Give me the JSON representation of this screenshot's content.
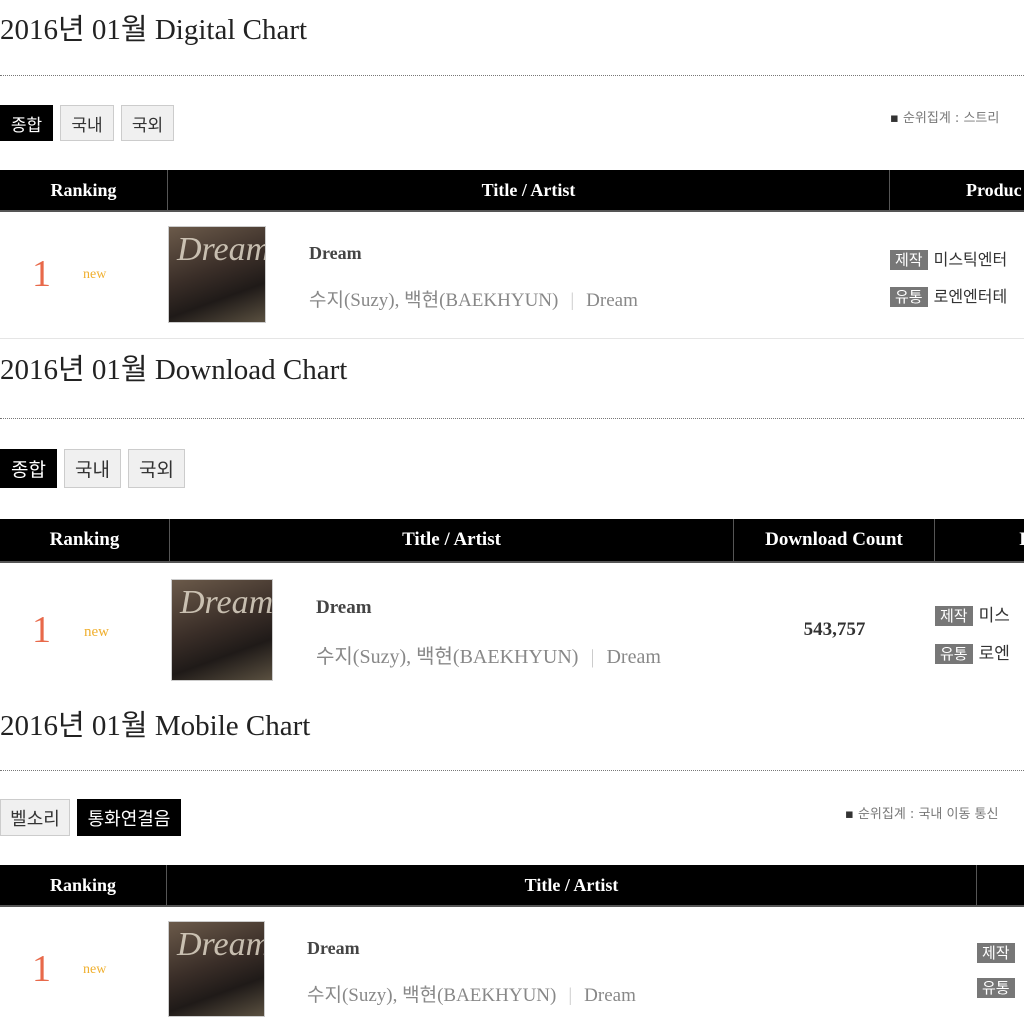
{
  "digital": {
    "title": "2016년 01월 Digital Chart",
    "tabs": [
      "종합",
      "국내",
      "국외"
    ],
    "note": "순위집계 : 스트리",
    "headers": [
      "Ranking",
      "Title / Artist",
      "Produc"
    ],
    "rows": [
      {
        "rank": "1",
        "badge": "new",
        "song": "Dream",
        "artist": "수지(Suzy), 백현(BAEKHYUN)",
        "album": "Dream",
        "producer_label": "제작",
        "producer": "미스틱엔터",
        "distributor_label": "유통",
        "distributor": "로엔엔터테"
      }
    ]
  },
  "download": {
    "title": "2016년 01월 Download Chart",
    "tabs": [
      "종합",
      "국내",
      "국외"
    ],
    "headers": [
      "Ranking",
      "Title / Artist",
      "Download Count",
      "I"
    ],
    "rows": [
      {
        "rank": "1",
        "badge": "new",
        "song": "Dream",
        "artist": "수지(Suzy), 백현(BAEKHYUN)",
        "album": "Dream",
        "count": "543,757",
        "producer_label": "제작",
        "producer": "미스",
        "distributor_label": "유통",
        "distributor": "로엔"
      }
    ]
  },
  "mobile": {
    "title": "2016년 01월 Mobile Chart",
    "tabs": [
      "벨소리",
      "통화연결음"
    ],
    "note": "순위집계 : 국내 이동 통신",
    "headers": [
      "Ranking",
      "Title / Artist",
      ""
    ],
    "rows": [
      {
        "rank": "1",
        "badge": "new",
        "song": "Dream",
        "artist": "수지(Suzy), 백현(BAEKHYUN)",
        "album": "Dream",
        "producer_label": "제작",
        "distributor_label": "유통"
      }
    ]
  },
  "album_art_text": "Dream"
}
